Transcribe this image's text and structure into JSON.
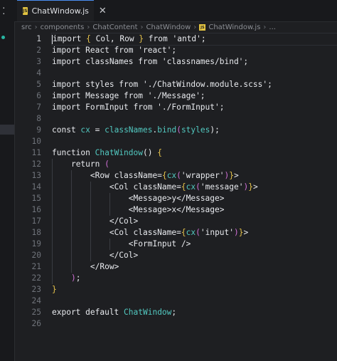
{
  "tab": {
    "filename": "ChatWindow.js",
    "icon": "JS",
    "close": "✕"
  },
  "breadcrumb": [
    "src",
    "components",
    "ChatContent",
    "ChatWindow",
    "ChatWindow.js",
    "..."
  ],
  "line_numbers": [
    "1",
    "2",
    "3",
    "4",
    "5",
    "6",
    "7",
    "8",
    "9",
    "10",
    "11",
    "12",
    "13",
    "14",
    "15",
    "16",
    "17",
    "18",
    "19",
    "20",
    "21",
    "22",
    "23",
    "24",
    "25",
    "26"
  ],
  "code": {
    "l1": [
      "import",
      " { ",
      "Col",
      ", ",
      "Row",
      " } ",
      "from",
      " 'antd';"
    ],
    "l2": "import React from 'react';",
    "l3": "import classNames from 'classnames/bind';",
    "l5": "import styles from './ChatWindow.module.scss';",
    "l6": "import Message from './Message';",
    "l7": "import FormInput from './FormInput';",
    "l9": [
      "const ",
      "cx",
      " = ",
      "classNames",
      ".",
      "bind",
      "(",
      "styles",
      ");"
    ],
    "l11": [
      "function ",
      "ChatWindow",
      "() ",
      "{"
    ],
    "l12": [
      "return ",
      "("
    ],
    "l13": [
      "<Row className=",
      "{",
      "cx",
      "(",
      "'wrapper'",
      ")",
      "}",
      ">"
    ],
    "l14": [
      "<Col className=",
      "{",
      "cx",
      "(",
      "'message'",
      ")",
      "}",
      ">"
    ],
    "l15": "<Message>y</Message>",
    "l16": "<Message>x</Message>",
    "l17": "</Col>",
    "l18": [
      "<Col className=",
      "{",
      "cx",
      "(",
      "'input'",
      ")",
      "}",
      ">"
    ],
    "l19": "<FormInput />",
    "l20": "</Col>",
    "l21": "</Row>",
    "l22": [
      ")",
      ";"
    ],
    "l23": "}",
    "l25": [
      "export default ",
      "ChatWindow",
      ";"
    ]
  }
}
